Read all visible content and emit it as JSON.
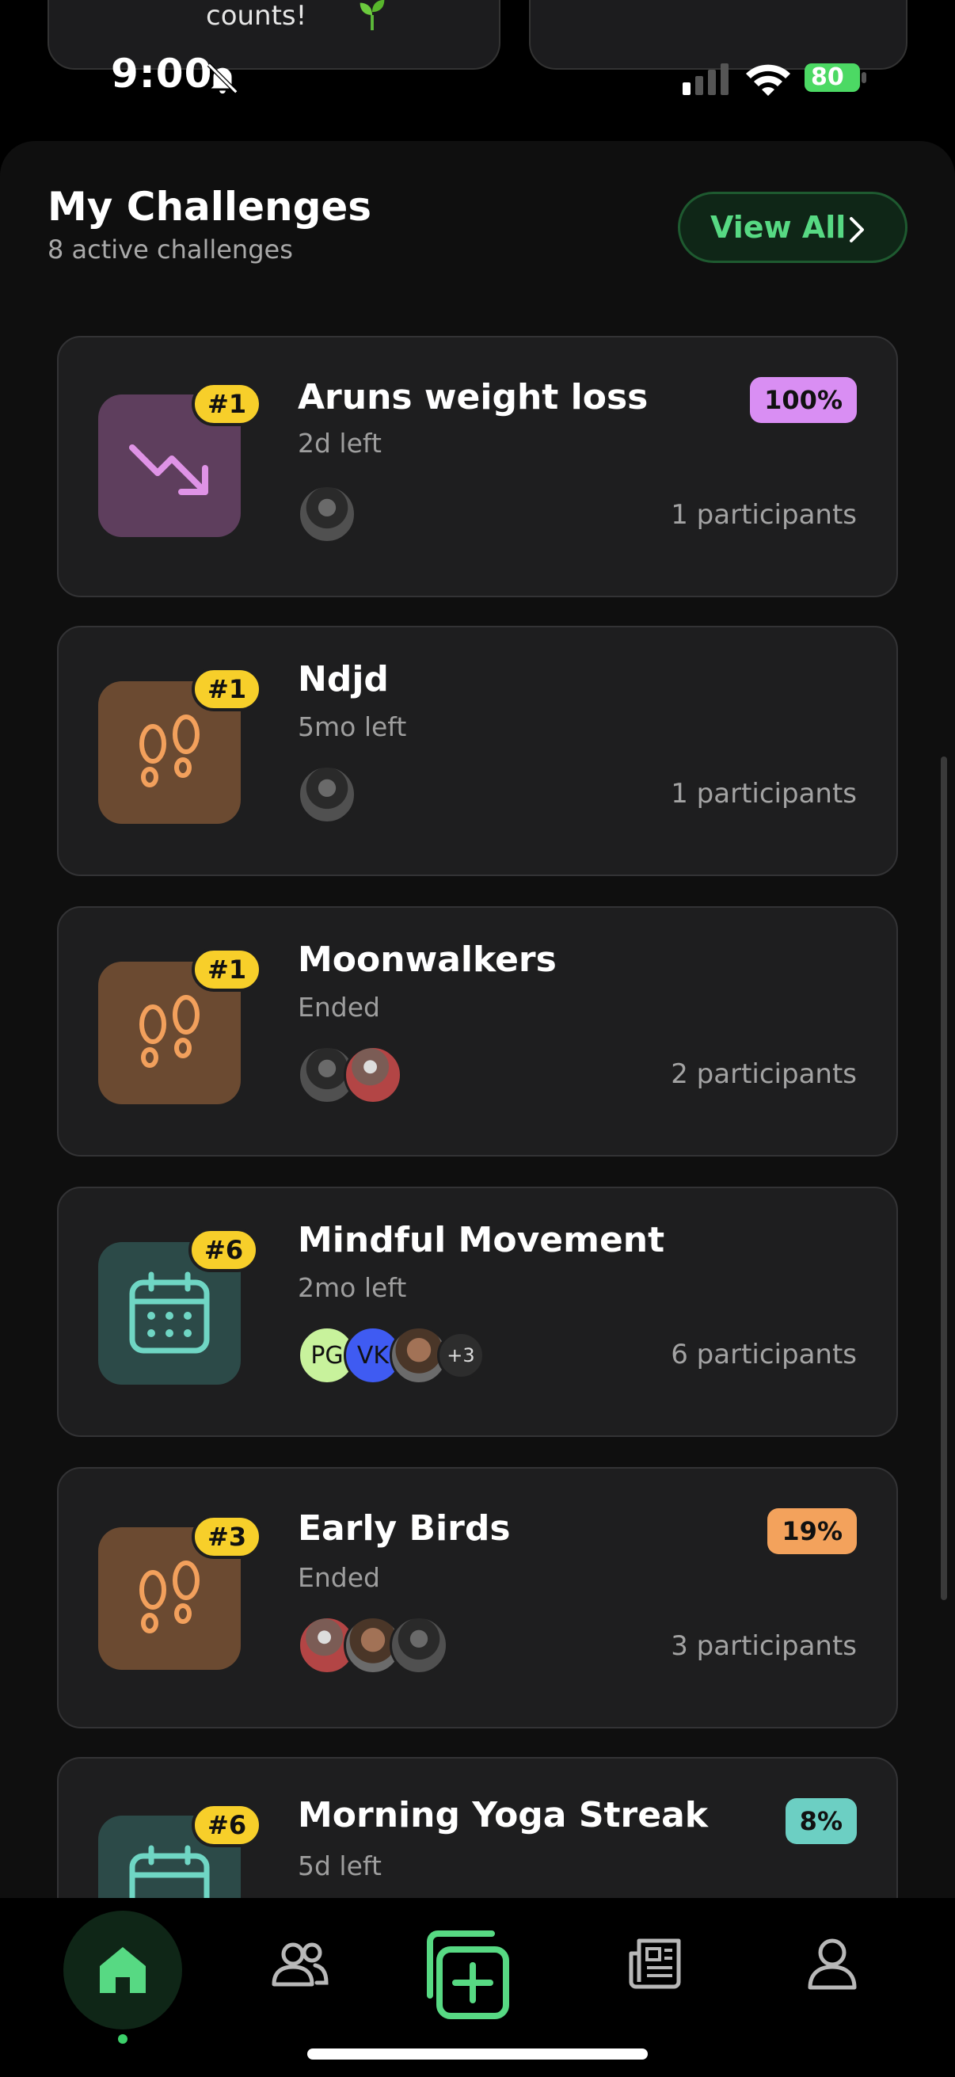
{
  "top_peek": {
    "text": "counts!"
  },
  "status_bar": {
    "time": "9:00",
    "battery": "80"
  },
  "section": {
    "title": "My Challenges",
    "subtitle": "8 active challenges",
    "view_all_label": "View All"
  },
  "challenges": [
    {
      "rank": "#1",
      "title": "Aruns weight loss",
      "status": "2d left",
      "participants": "1 participants",
      "percent": "100%",
      "icon": "trending-down-icon",
      "tile_color": "#5e3e5d",
      "percent_color": "#d98ef3"
    },
    {
      "rank": "#1",
      "title": "Ndjd",
      "status": "5mo left",
      "participants": "1 participants",
      "icon": "footprints-icon",
      "tile_color": "#6b4a31"
    },
    {
      "rank": "#1",
      "title": "Moonwalkers",
      "status": "Ended",
      "participants": "2 participants",
      "icon": "footprints-icon",
      "tile_color": "#6b4a31"
    },
    {
      "rank": "#6",
      "title": "Mindful Movement",
      "status": "2mo left",
      "participants": "6 participants",
      "icon": "calendar-icon",
      "tile_color": "#2c4a48",
      "avatars": [
        "PG",
        "VK"
      ],
      "more_avatars": "+3"
    },
    {
      "rank": "#3",
      "title": "Early Birds",
      "status": "Ended",
      "participants": "3 participants",
      "percent": "19%",
      "icon": "footprints-icon",
      "tile_color": "#6b4a31",
      "percent_color": "#f3a25c"
    },
    {
      "rank": "#6",
      "title": "Morning Yoga Streak",
      "status": "5d left",
      "percent": "8%",
      "icon": "calendar-icon",
      "tile_color": "#2c4a48",
      "percent_color": "#6ccfc3"
    }
  ],
  "nav": {
    "items": [
      "home-icon",
      "people-icon",
      "add-challenge-icon",
      "news-icon",
      "profile-icon"
    ],
    "active": "home-icon",
    "accent": "#3ccf6a"
  }
}
